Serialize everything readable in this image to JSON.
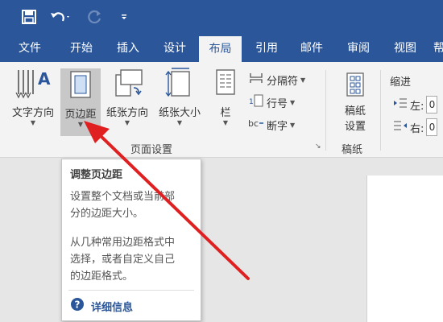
{
  "tabs": [
    {
      "label": "文件"
    },
    {
      "label": "开始"
    },
    {
      "label": "插入"
    },
    {
      "label": "设计"
    },
    {
      "label": "布局",
      "active": true
    },
    {
      "label": "引用"
    },
    {
      "label": "邮件"
    },
    {
      "label": "审阅"
    },
    {
      "label": "视图"
    },
    {
      "label": "帮"
    }
  ],
  "ribbon": {
    "text_direction": "文字方向",
    "margins": "页边距",
    "orientation": "纸张方向",
    "size": "纸张大小",
    "columns": "栏",
    "breaks": "分隔符",
    "line_numbers": "行号",
    "hyphenation": "断字",
    "group_page_setup": "页面设置",
    "draft_setup_line1": "稿纸",
    "draft_setup_line2": "设置",
    "group_draft": "稿纸",
    "indent_title": "缩进",
    "indent_left": "左:",
    "indent_left_value": "0",
    "indent_right": "右:",
    "indent_right_value": "0"
  },
  "tooltip": {
    "title": "调整页边距",
    "body1_line1": "设置整个文档或当前部",
    "body1_line2": "分的边距大小。",
    "body2_line1": "从几种常用边距格式中",
    "body2_line2": "选择，或者自定义自己",
    "body2_line3": "的边距格式。",
    "more": "详细信息"
  },
  "colors": {
    "brand": "#2b579a",
    "arrow": "#e02020"
  }
}
